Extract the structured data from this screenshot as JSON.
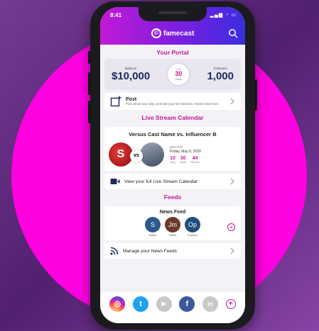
{
  "status": {
    "time": "8:41",
    "icons": "▂▄▆ ◔ ▭"
  },
  "header": {
    "logo_mark": "©",
    "logo_text": "famecast"
  },
  "portal": {
    "title": "Your Portal",
    "left_label": "Balance",
    "left_value": "$10,000",
    "badge_small": "LIVE",
    "badge_num": "30",
    "badge_label": "Days",
    "right_label": "Followers",
    "right_value": "1,000"
  },
  "post": {
    "title": "Post",
    "subtitle": "Post about your day, promote your live streams, stories and more"
  },
  "live": {
    "title": "Live Stream Calendar",
    "versus_title": "Versus Cast Name vs. Influencer B",
    "avatar_a": "S",
    "vs": "vs",
    "time": "8pm PST",
    "date": "Friday, May 8, 2020",
    "countdown": [
      {
        "num": "10",
        "unit": "Days"
      },
      {
        "num": "30",
        "unit": "Hours"
      },
      {
        "num": "44",
        "unit": "Minutes"
      }
    ],
    "calendar_link": "View your full Live Stream Calendar"
  },
  "feeds": {
    "title": "Feeds",
    "news_feed_title": "News Feed",
    "people": [
      {
        "initials": "S",
        "label": "Saber",
        "color": "#2b5a8a"
      },
      {
        "initials": "Jm",
        "label": "JryMx",
        "color": "#6a3a2a"
      },
      {
        "initials": "Op",
        "label": "Coartun",
        "color": "#1f4f7a"
      }
    ],
    "add": "+",
    "manage_link": "Manage your News Feeds"
  },
  "social": [
    {
      "name": "instagram",
      "glyph": "◎",
      "color": "#d6249f"
    },
    {
      "name": "twitter",
      "glyph": "t",
      "color": "#1da1f2"
    },
    {
      "name": "youtube",
      "glyph": "▶",
      "color": "#c8c8c8"
    },
    {
      "name": "facebook",
      "glyph": "f",
      "color": "#3b5998"
    },
    {
      "name": "linkedin",
      "glyph": "in",
      "color": "#c8c8c8"
    },
    {
      "name": "add",
      "glyph": "+",
      "color": "#ffffff"
    }
  ],
  "colors": {
    "accent": "#c2189a",
    "background_circle": "#ff00e1"
  }
}
